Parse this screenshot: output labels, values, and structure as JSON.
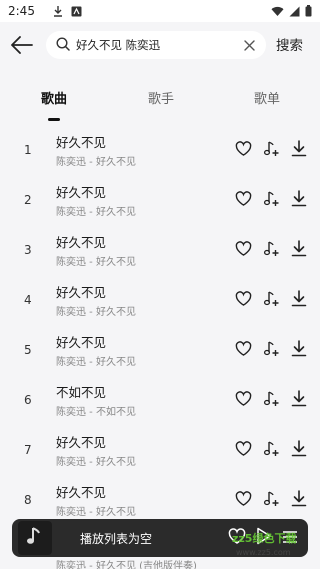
{
  "status_bar": {
    "time": "2:45",
    "icons": [
      "download-icon",
      "storage-icon",
      "wifi-icon",
      "signal-icon",
      "battery-icon"
    ]
  },
  "search": {
    "query": "好久不见 陈奕迅",
    "submit_label": "搜索"
  },
  "tabs": [
    {
      "label": "歌曲",
      "active": true
    },
    {
      "label": "歌手",
      "active": false
    },
    {
      "label": "歌单",
      "active": false
    }
  ],
  "songs": [
    {
      "num": "1",
      "title": "好久不见",
      "subtitle": "陈奕迅 - 好久不见"
    },
    {
      "num": "2",
      "title": "好久不见",
      "subtitle": "陈奕迅 - 好久不见"
    },
    {
      "num": "3",
      "title": "好久不见",
      "subtitle": "陈奕迅 - 好久不见"
    },
    {
      "num": "4",
      "title": "好久不见",
      "subtitle": "陈奕迅 - 好久不见"
    },
    {
      "num": "5",
      "title": "好久不见",
      "subtitle": "陈奕迅 - 好久不见"
    },
    {
      "num": "6",
      "title": "不如不见",
      "subtitle": "陈奕迅 - 不如不见"
    },
    {
      "num": "7",
      "title": "好久不见",
      "subtitle": "陈奕迅 - 好久不见"
    },
    {
      "num": "8",
      "title": "好久不见",
      "subtitle": "陈奕迅 - 好久不见"
    }
  ],
  "partial_row_subtitle": "陈奕迅 - 好久不见 (吉他版伴奏)",
  "player": {
    "status_text": "播放列表为空"
  },
  "watermark": {
    "text": "zz5绿色下载",
    "url": "www.zz5.com"
  },
  "colors": {
    "background": "#f5f5f7",
    "player_bg": "#2b2b2b",
    "watermark_green": "#66cc33"
  }
}
